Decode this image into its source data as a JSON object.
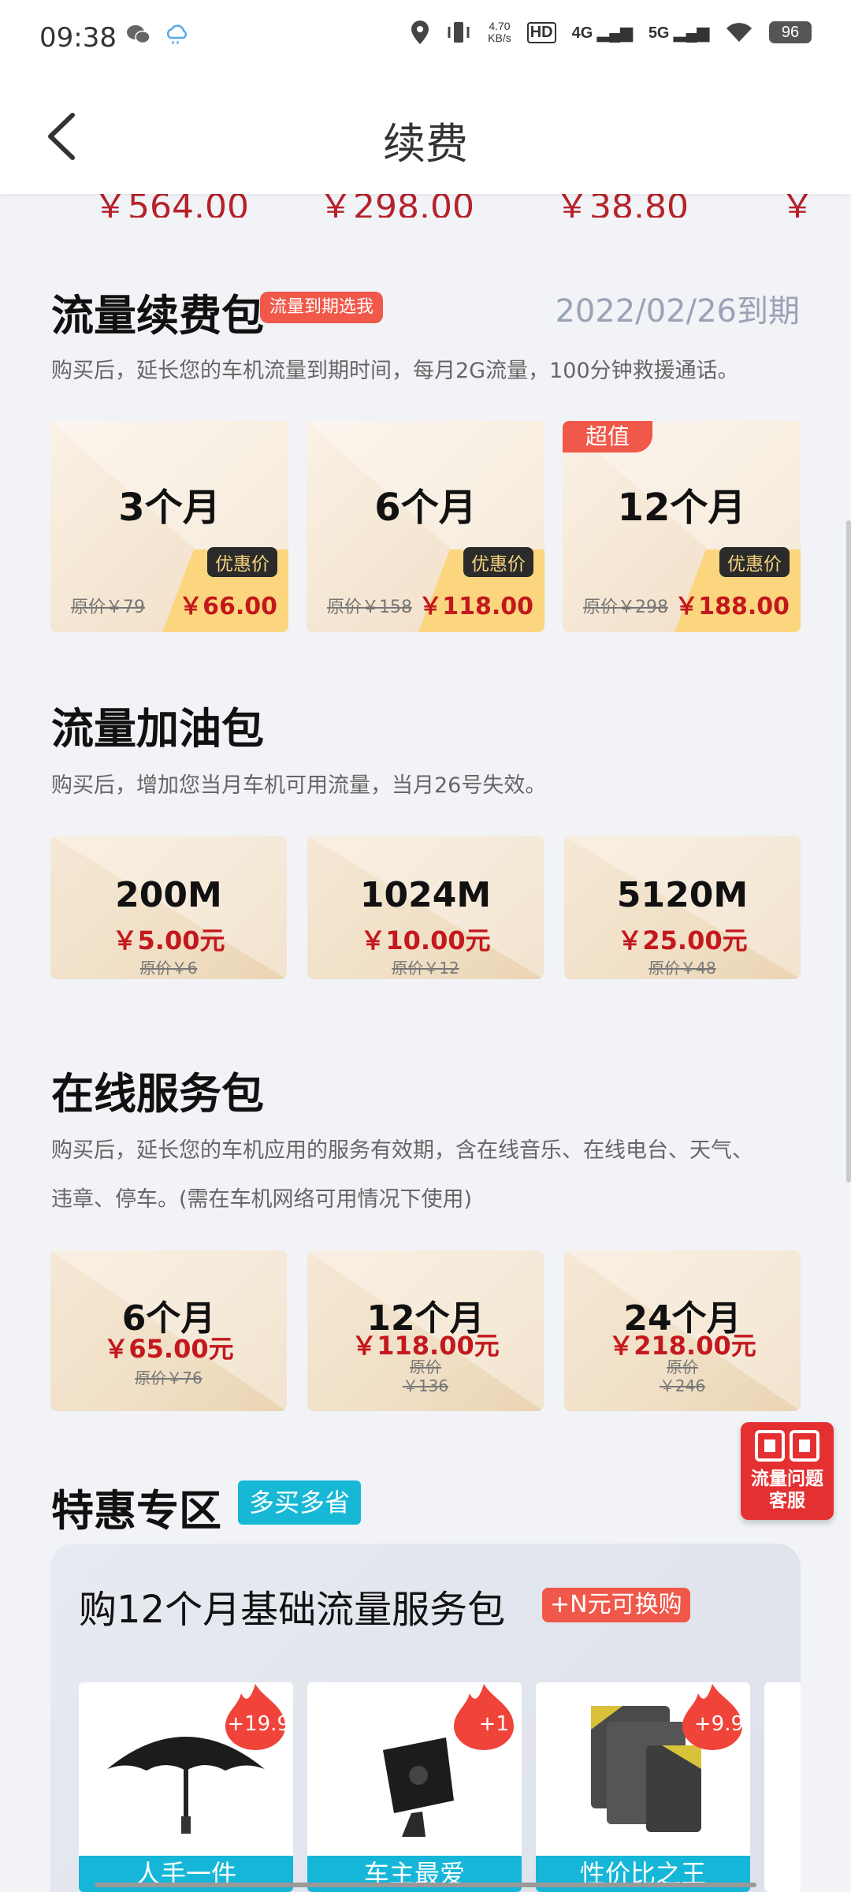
{
  "status_bar": {
    "time": "09:38",
    "speed_top": "4.70",
    "speed_unit": "KB/s",
    "hd": "HD",
    "net_4g": "4G",
    "net_5g": "5G",
    "battery": "96",
    "icons": [
      "wechat-icon",
      "cloud-icon",
      "location-icon",
      "vibrate-icon",
      "hd-icon",
      "signal-icon",
      "wifi-icon",
      "battery-icon"
    ]
  },
  "nav": {
    "title": "续费",
    "back_icon": "chevron-left-icon"
  },
  "prev_prices": [
    "￥564.00",
    "￥298.00",
    "￥38.80",
    "￥"
  ],
  "renew": {
    "title": "流量续费包",
    "tag": "流量到期选我",
    "expire": "2022/02/26到期",
    "desc": "购买后，延长您的车机流量到期时间，每月2G流量，100分钟救援通话。",
    "cards": [
      {
        "months": "3个月",
        "promo_label": "优惠价",
        "orig": "原价￥79",
        "price": "￥66.00"
      },
      {
        "months": "6个月",
        "promo_label": "优惠价",
        "orig": "原价￥158",
        "price": "￥118.00"
      },
      {
        "months": "12个月",
        "promo_label": "优惠价",
        "orig": "原价￥298",
        "price": "￥188.00",
        "super": "超值"
      }
    ]
  },
  "refuel": {
    "title": "流量加油包",
    "desc": "购买后，增加您当月车机可用流量，当月26号失效。",
    "cards": [
      {
        "size": "200M",
        "price": "￥5.00元",
        "orig": "原价￥6"
      },
      {
        "size": "1024M",
        "price": "￥10.00元",
        "orig": "原价￥12"
      },
      {
        "size": "5120M",
        "price": "￥25.00元",
        "orig": "原价￥48"
      }
    ]
  },
  "service": {
    "title": "在线服务包",
    "desc_line1": "购买后，延长您的车机应用的服务有效期，含在线音乐、在线电台、天气、",
    "desc_line2": "违章、停车。(需在车机网络可用情况下使用)",
    "cards": [
      {
        "size": "6个月",
        "price": "￥65.00元",
        "orig": "原价￥76"
      },
      {
        "size": "12个月",
        "price": "￥118.00元",
        "orig_a": "原价",
        "orig_b": "￥136"
      },
      {
        "size": "24个月",
        "price": "￥218.00元",
        "orig_a": "原价",
        "orig_b": "￥246"
      }
    ]
  },
  "special": {
    "title": "特惠专区",
    "tag": "多买多省",
    "deal_title": "购12个月基础流量服务包",
    "deal_tag": "+N元可换购",
    "products": [
      {
        "bar": "人手一件",
        "addon": "+19.9",
        "image": "umbrella-icon"
      },
      {
        "bar": "车主最爱",
        "addon": "+1",
        "image": "phone-holder-icon"
      },
      {
        "bar": "性价比之王",
        "addon": "+9.9",
        "image": "towel-icon"
      }
    ]
  },
  "float_service": {
    "line1": "流量问题",
    "line2": "客服"
  },
  "colors": {
    "price_red": "#c3181e",
    "accent_red": "#f0584a",
    "accent_cyan": "#16b6d8",
    "card_gold": "#fcd67e"
  }
}
